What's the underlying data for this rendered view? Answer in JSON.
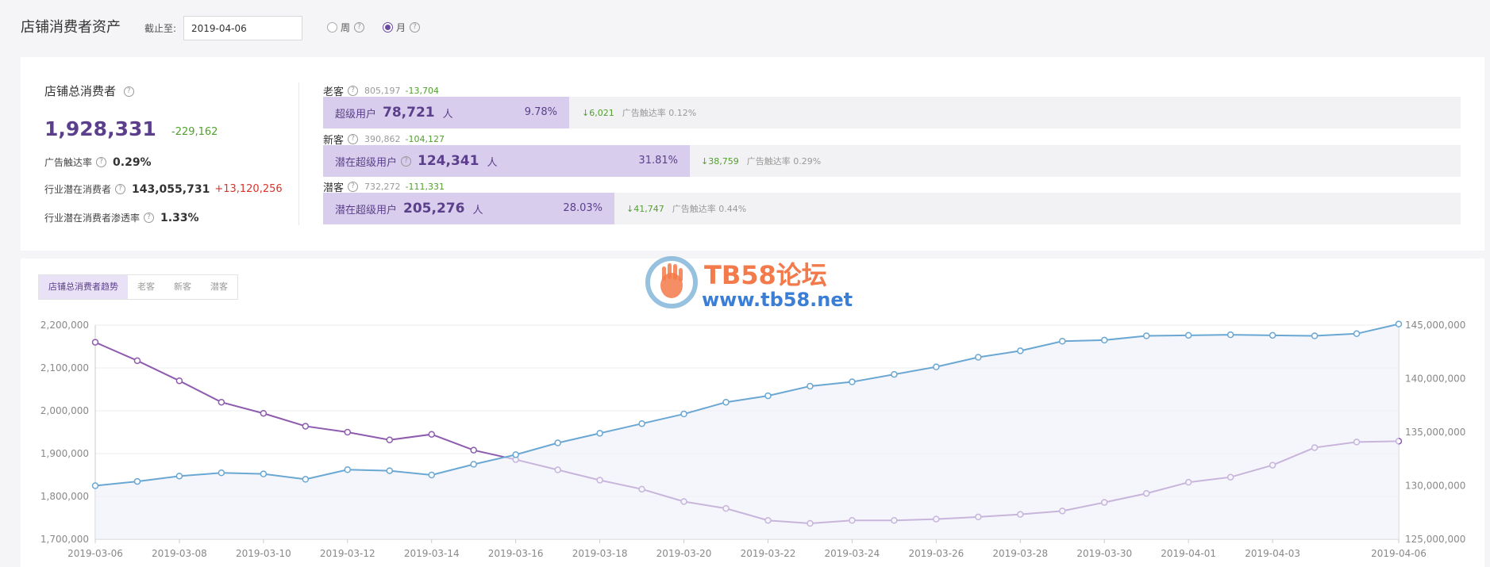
{
  "header": {
    "title": "店铺消费者资产",
    "date_label": "截止至:",
    "date_value": "2019-04-06",
    "radio_week": "周",
    "radio_month": "月",
    "selected": "月"
  },
  "summary": {
    "title": "店铺总消费者",
    "total": "1,928,331",
    "total_delta": "-229,162",
    "ad_reach_label": "广告触达率",
    "ad_reach_value": "0.29%",
    "industry_potential_label": "行业潜在消费者",
    "industry_potential_value": "143,055,731",
    "industry_potential_delta": "+13,120,256",
    "penetration_label": "行业潜在消费者渗透率",
    "penetration_value": "1.33%"
  },
  "segments": [
    {
      "name": "老客",
      "count": "805,197",
      "delta": "-13,704",
      "bar_label": "超级用户",
      "bar_value": "78,721",
      "unit": "人",
      "pct": "9.78%",
      "change": "↓6,021",
      "reach": "广告触达率 0.12%"
    },
    {
      "name": "新客",
      "count": "390,862",
      "delta": "-104,127",
      "bar_label": "潜在超级用户",
      "bar_value": "124,341",
      "unit": "人",
      "pct": "31.81%",
      "change": "↓38,759",
      "reach": "广告触达率 0.29%"
    },
    {
      "name": "潜客",
      "count": "732,272",
      "delta": "-111,331",
      "bar_label": "潜在超级用户",
      "bar_value": "205,276",
      "unit": "人",
      "pct": "28.03%",
      "change": "↓41,747",
      "reach": "广告触达率 0.44%"
    }
  ],
  "tabs": [
    "店铺总消费者趋势",
    "老客",
    "新客",
    "潜客"
  ],
  "watermark": {
    "title": "TB58论坛",
    "url": "www.tb58.net"
  },
  "icons": {
    "help": "question-circle-icon",
    "logo": "hand-logo-icon"
  },
  "colors": {
    "purple": "#8e5cae",
    "blue": "#6aa7d2",
    "accent": "#5b3f8c"
  },
  "chart_data": {
    "type": "line",
    "x": [
      "2019-03-06",
      "2019-03-07",
      "2019-03-08",
      "2019-03-09",
      "2019-03-10",
      "2019-03-11",
      "2019-03-12",
      "2019-03-13",
      "2019-03-14",
      "2019-03-15",
      "2019-03-16",
      "2019-03-17",
      "2019-03-18",
      "2019-03-19",
      "2019-03-20",
      "2019-03-21",
      "2019-03-22",
      "2019-03-23",
      "2019-03-24",
      "2019-03-25",
      "2019-03-26",
      "2019-03-27",
      "2019-03-28",
      "2019-03-29",
      "2019-03-30",
      "2019-03-31",
      "2019-04-01",
      "2019-04-02",
      "2019-04-03",
      "2019-04-04",
      "2019-04-05",
      "2019-04-06"
    ],
    "x_ticks": [
      "2019-03-06",
      "2019-03-08",
      "2019-03-10",
      "2019-03-12",
      "2019-03-14",
      "2019-03-16",
      "2019-03-18",
      "2019-03-20",
      "2019-03-22",
      "2019-03-24",
      "2019-03-26",
      "2019-03-28",
      "2019-03-30",
      "2019-04-01",
      "2019-04-03",
      "2019-04-06"
    ],
    "y_left_ticks": [
      "1,700,000",
      "1,800,000",
      "1,900,000",
      "2,000,000",
      "2,100,000",
      "2,200,000"
    ],
    "y_right_ticks": [
      "125,000,000",
      "130,000,000",
      "135,000,000",
      "140,000,000",
      "145,000,000"
    ],
    "ylim_left": [
      1700000,
      2200000
    ],
    "ylim_right": [
      125000000,
      145000000
    ],
    "grid": true,
    "series": [
      {
        "axis": "left",
        "values": [
          2160000,
          2117000,
          2070000,
          2020000,
          1994000,
          1964000,
          1950000,
          1932000,
          1945000,
          1908000,
          1886000,
          1862000,
          1838000,
          1817000,
          1788000,
          1772000,
          1744000,
          1737000,
          1744000,
          1744000,
          1747000,
          1752000,
          1758000,
          1766000,
          1786000,
          1807000,
          1833000,
          1845000,
          1873000,
          1914000,
          1927000,
          1929000
        ]
      },
      {
        "axis": "right",
        "values": [
          130000000,
          130400000,
          130900000,
          131200000,
          131100000,
          130600000,
          131500000,
          131400000,
          131000000,
          132000000,
          132900000,
          134000000,
          134900000,
          135800000,
          136700000,
          137800000,
          138400000,
          139300000,
          139700000,
          140400000,
          141100000,
          142000000,
          142600000,
          143500000,
          143600000,
          144000000,
          144050000,
          144100000,
          144050000,
          144000000,
          144200000,
          145100000
        ]
      }
    ]
  }
}
